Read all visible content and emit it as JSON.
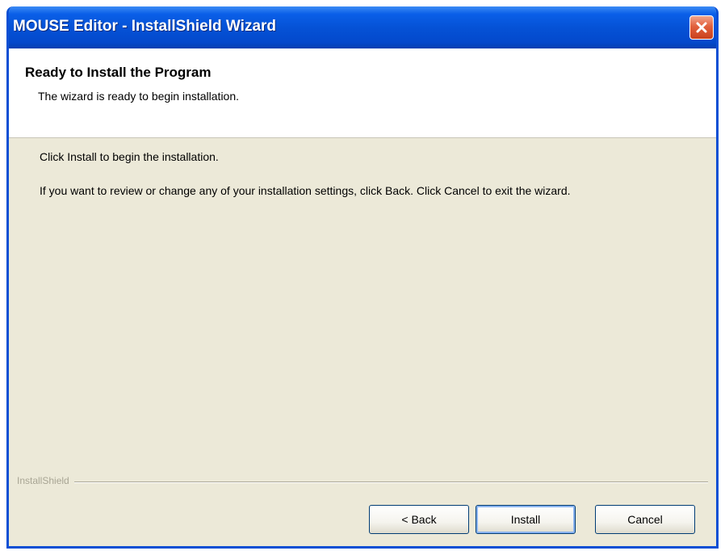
{
  "window": {
    "title": "MOUSE Editor - InstallShield Wizard"
  },
  "header": {
    "title": "Ready to Install the Program",
    "subtitle": "The wizard is ready to begin installation."
  },
  "body": {
    "line1": "Click Install to begin the installation.",
    "line2": "If you want to review or change any of your installation settings, click Back. Click Cancel to exit the wizard."
  },
  "footer": {
    "brand": "InstallShield"
  },
  "buttons": {
    "back": "< Back",
    "install": "Install",
    "cancel": "Cancel"
  },
  "colors": {
    "titlebar": "#0552d6",
    "dialog_bg": "#ece9d8",
    "close_button": "#e2613d"
  },
  "icons": {
    "close": "close-icon"
  }
}
